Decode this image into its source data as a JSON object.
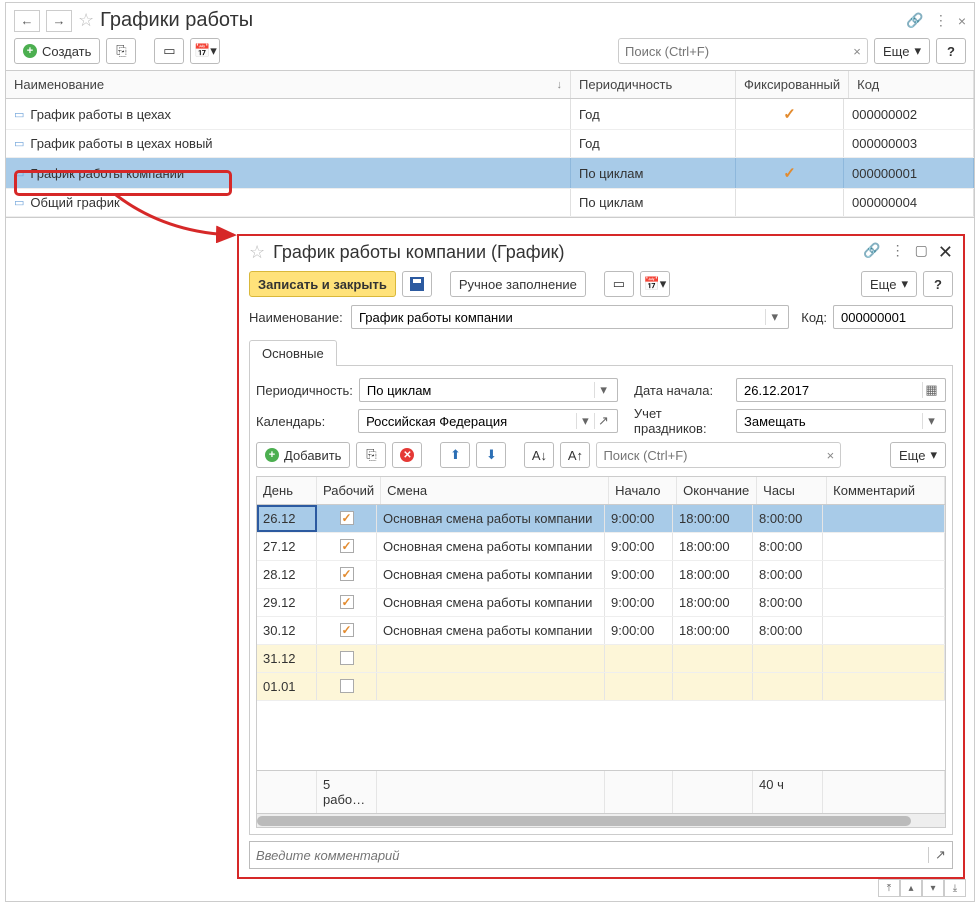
{
  "header": {
    "title": "Графики работы",
    "search_placeholder": "Поиск (Ctrl+F)",
    "more_label": "Еще",
    "create_label": "Создать",
    "help_label": "?"
  },
  "grid": {
    "columns": {
      "name": "Наименование",
      "period": "Периодичность",
      "fixed": "Фиксированный",
      "code": "Код"
    },
    "rows": [
      {
        "name": "График работы в цехах",
        "period": "Год",
        "fixed": true,
        "code": "000000002"
      },
      {
        "name": "График работы в цехах новый",
        "period": "Год",
        "fixed": false,
        "code": "000000003"
      },
      {
        "name": "График работы компании",
        "period": "По циклам",
        "fixed": true,
        "code": "000000001"
      },
      {
        "name": "Общий график",
        "period": "По циклам",
        "fixed": false,
        "code": "000000004"
      }
    ],
    "selected_index": 2
  },
  "dialog": {
    "title": "График работы компании (График)",
    "save_close": "Записать и закрыть",
    "manual_fill": "Ручное заполнение",
    "more_label": "Еще",
    "help_label": "?",
    "name_label": "Наименование:",
    "name_value": "График работы компании",
    "code_label": "Код:",
    "code_value": "000000001",
    "tab_main": "Основные",
    "period_label": "Периодичность:",
    "period_value": "По циклам",
    "start_label": "Дата начала:",
    "start_value": "26.12.2017",
    "calendar_label": "Календарь:",
    "calendar_value": "Российская Федерация",
    "holidays_label": "Учет праздников:",
    "holidays_value": "Замещать",
    "add_label": "Добавить",
    "search_placeholder": "Поиск (Ctrl+F)",
    "cols": {
      "day": "День",
      "work": "Рабочий",
      "shift": "Смена",
      "start": "Начало",
      "end": "Окончание",
      "hours": "Часы",
      "comment": "Комментарий"
    },
    "rows": [
      {
        "day": "26.12",
        "work": true,
        "shift": "Основная смена работы компании",
        "start": "9:00:00",
        "end": "18:00:00",
        "hours": "8:00:00",
        "selected": true
      },
      {
        "day": "27.12",
        "work": true,
        "shift": "Основная смена работы компании",
        "start": "9:00:00",
        "end": "18:00:00",
        "hours": "8:00:00"
      },
      {
        "day": "28.12",
        "work": true,
        "shift": "Основная смена работы компании",
        "start": "9:00:00",
        "end": "18:00:00",
        "hours": "8:00:00"
      },
      {
        "day": "29.12",
        "work": true,
        "shift": "Основная смена работы компании",
        "start": "9:00:00",
        "end": "18:00:00",
        "hours": "8:00:00"
      },
      {
        "day": "30.12",
        "work": true,
        "shift": "Основная смена работы компании",
        "start": "9:00:00",
        "end": "18:00:00",
        "hours": "8:00:00"
      },
      {
        "day": "31.12",
        "work": false,
        "shift": "",
        "start": "",
        "end": "",
        "hours": "",
        "weekend": true
      },
      {
        "day": "01.01",
        "work": false,
        "shift": "",
        "start": "",
        "end": "",
        "hours": "",
        "weekend": true
      }
    ],
    "summary_work": "5 рабо…",
    "summary_hours": "40 ч",
    "comment_placeholder": "Введите комментарий"
  }
}
